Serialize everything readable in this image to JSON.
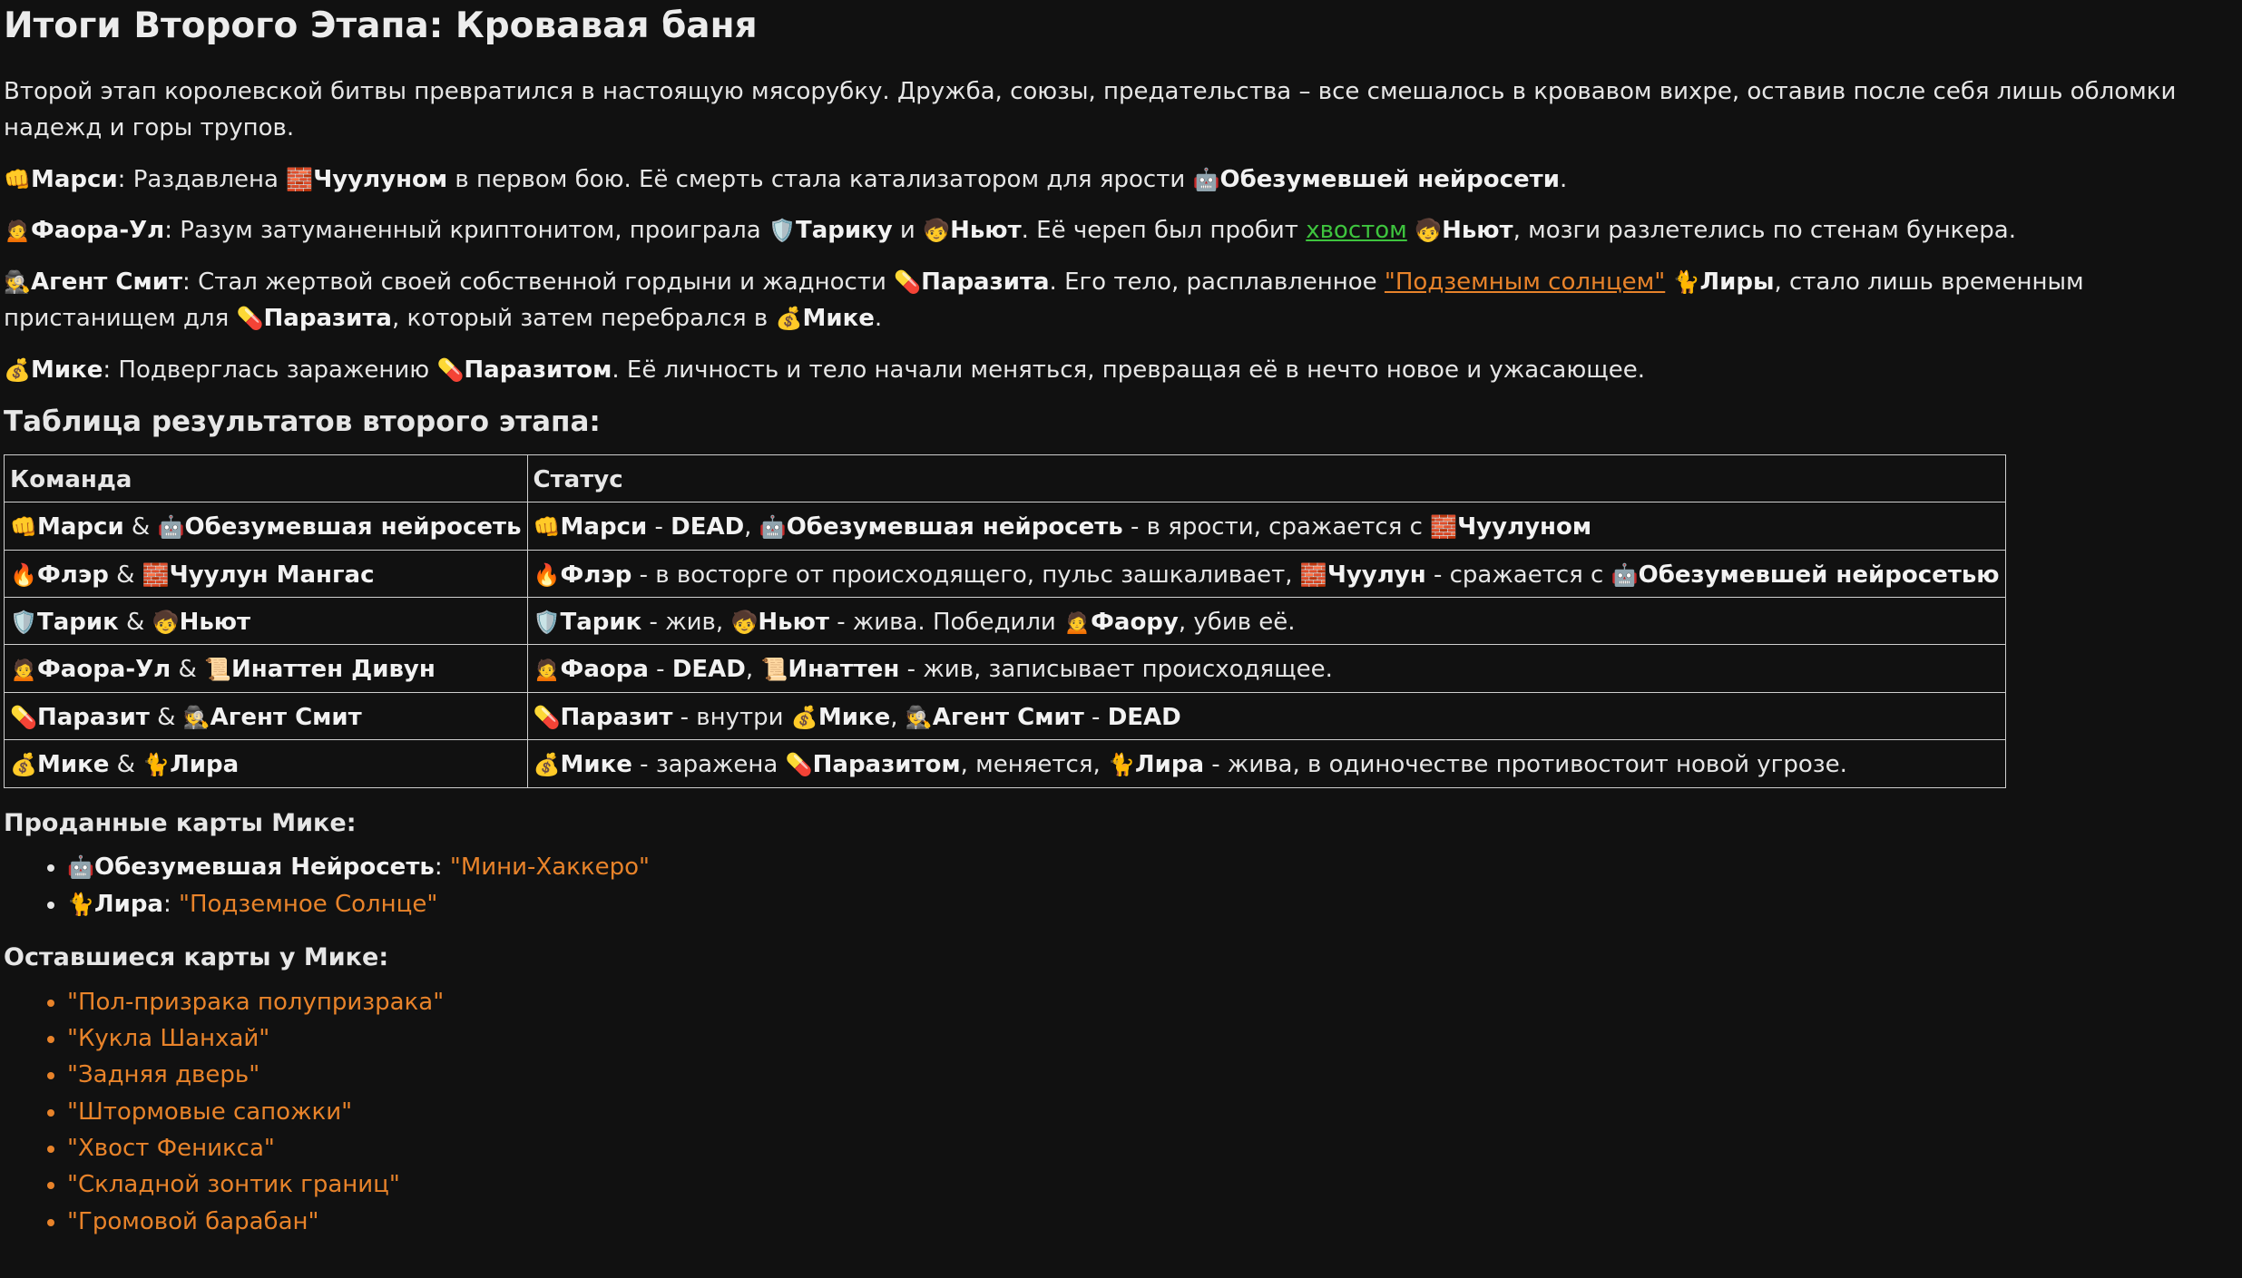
{
  "title": "Итоги Второго Этапа: Кровавая баня",
  "intro": "Второй этап королевской битвы превратился в настоящую мясорубку. Дружба, союзы, предательства – все смешалось в кровавом вихре, оставив после себя лишь обломки надежд и горы трупов.",
  "emoji": {
    "fist": "👊",
    "bricks": "🧱",
    "robot": "🤖",
    "pouting": "🙍",
    "shield": "🛡️",
    "kid": "🧒",
    "spy": "🕵️",
    "pill": "💊",
    "bag": "💰",
    "cat": "🐈",
    "fire": "🔥",
    "scroll": "📜"
  },
  "paragraphs": {
    "marsi": {
      "name": "Марси",
      "t1": ": Раздавлена ",
      "b1": "Чуулуном",
      "t2": " в первом бою. Её смерть стала катализатором для ярости ",
      "b2": "Обезумевшей нейросети",
      "t3": "."
    },
    "faora": {
      "name": "Фаора-Ул",
      "t1": ": Разум затуманенный криптонитом, проиграла ",
      "b1": "Тарику",
      "t2": " и ",
      "b2": "Ньют",
      "t3": ". Её череп был пробит ",
      "link": "хвостом",
      "t4": " ",
      "b3": "Ньют",
      "t5": ", мозги разлетелись по стенам бункера."
    },
    "smith": {
      "name": "Агент Смит",
      "t1": ": Стал жертвой своей собственной гордыни и жадности ",
      "b1": "Паразита",
      "t2": ". Его тело, расплавленное ",
      "link": "\"Подземным солнцем\"",
      "t3": " ",
      "b2": "Лиры",
      "t4": ", стало лишь временным пристанищем для ",
      "b3": "Паразита",
      "t5": ", который затем перебрался в ",
      "b4": "Мике",
      "t6": "."
    },
    "mike": {
      "name": "Мике",
      "t1": ": Подверглась заражению ",
      "b1": "Паразитом",
      "t2": ". Её личность и тело начали меняться, превращая её в нечто новое и ужасающее."
    }
  },
  "table": {
    "title": "Таблица результатов второго этапа:",
    "headers": [
      "Команда",
      "Статус"
    ],
    "rows": [
      {
        "team": {
          "a": "Марси",
          "amp": " & ",
          "b": "Обезумевшая нейросеть"
        },
        "status": {
          "b1": "Марси",
          "t1": " - ",
          "b2": "DEAD",
          "t2": ", ",
          "b3": "Обезумевшая нейросеть",
          "t3": " - в ярости, сражается с ",
          "b4": "Чуулуном"
        }
      },
      {
        "team": {
          "a": "Флэр",
          "amp": " & ",
          "b": "Чуулун Мангас"
        },
        "status": {
          "b1": "Флэр",
          "t1": " - в восторге от происходящего, пульс зашкаливает, ",
          "b2": "Чуулун",
          "t2": " - сражается с ",
          "b3": "Обезумевшей нейросетью"
        }
      },
      {
        "team": {
          "a": "Тарик",
          "amp": " & ",
          "b": "Ньют"
        },
        "status": {
          "b1": "Тарик",
          "t1": " - жив, ",
          "b2": "Ньют",
          "t2": " - жива. Победили ",
          "b3": "Фаору",
          "t3": ", убив её."
        }
      },
      {
        "team": {
          "a": "Фаора-Ул",
          "amp": " & ",
          "b": "Инаттен Дивун"
        },
        "status": {
          "b1": "Фаора",
          "t1": " - ",
          "b2": "DEAD",
          "t2": ", ",
          "b3": "Инаттен",
          "t3": " - жив, записывает происходящее."
        }
      },
      {
        "team": {
          "a": "Паразит",
          "amp": " & ",
          "b": "Агент Смит"
        },
        "status": {
          "b1": "Паразит",
          "t1": " - внутри ",
          "b2": "Мике",
          "t2": ", ",
          "b3": "Агент Смит",
          "t3": " - ",
          "b4": "DEAD"
        }
      },
      {
        "team": {
          "a": "Мике",
          "amp": " & ",
          "b": "Лира"
        },
        "status": {
          "b1": "Мике",
          "t1": " - заражена ",
          "b2": "Паразитом",
          "t2": ", меняется, ",
          "b3": "Лира",
          "t3": " - жива, в одиночестве противостоит новой угрозе."
        }
      }
    ]
  },
  "sold": {
    "title": "Проданные карты Мике:",
    "items": [
      {
        "name": "Обезумевшая Нейросеть",
        "sep": ": ",
        "card": "\"Мини-Хаккеро\""
      },
      {
        "name": "Лира",
        "sep": ": ",
        "card": "\"Подземное Солнце\""
      }
    ]
  },
  "remaining": {
    "title": "Оставшиеся карты у Мике:",
    "items": [
      "\"Пол-призрака полупризрака\"",
      "\"Кукла Шанхай\"",
      "\"Задняя дверь\"",
      "\"Штормовые сапожки\"",
      "\"Хвост Феникса\"",
      "\"Складной зонтик границ\"",
      "\"Громовой барабан\""
    ]
  },
  "colors": {
    "background": "#111111",
    "text": "#e6e6e6",
    "link_green": "#3ec43e",
    "accent_orange": "#e8832a"
  }
}
